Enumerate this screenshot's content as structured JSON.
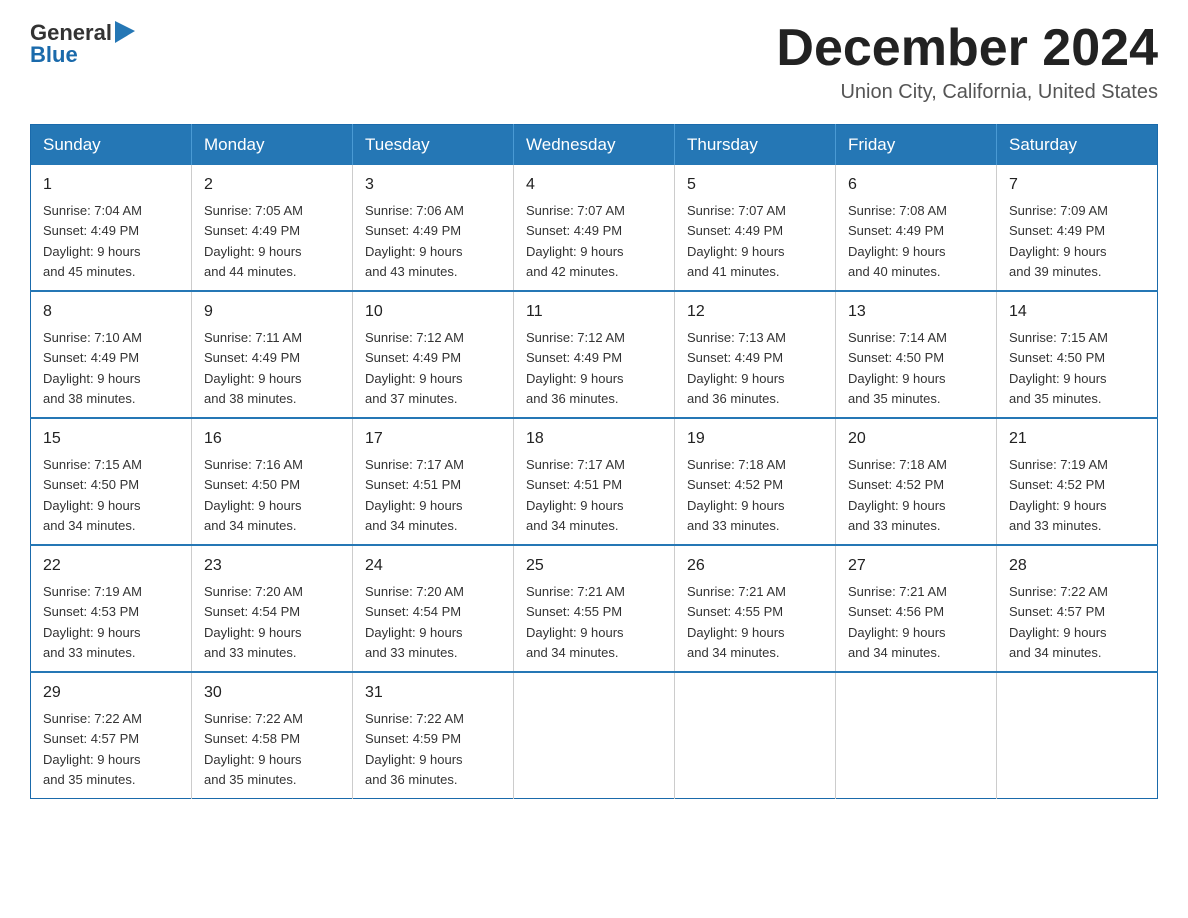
{
  "header": {
    "logo_general": "General",
    "logo_blue": "Blue",
    "month_title": "December 2024",
    "location": "Union City, California, United States"
  },
  "weekdays": [
    "Sunday",
    "Monday",
    "Tuesday",
    "Wednesday",
    "Thursday",
    "Friday",
    "Saturday"
  ],
  "weeks": [
    [
      {
        "day": "1",
        "sunrise": "7:04 AM",
        "sunset": "4:49 PM",
        "daylight": "9 hours and 45 minutes."
      },
      {
        "day": "2",
        "sunrise": "7:05 AM",
        "sunset": "4:49 PM",
        "daylight": "9 hours and 44 minutes."
      },
      {
        "day": "3",
        "sunrise": "7:06 AM",
        "sunset": "4:49 PM",
        "daylight": "9 hours and 43 minutes."
      },
      {
        "day": "4",
        "sunrise": "7:07 AM",
        "sunset": "4:49 PM",
        "daylight": "9 hours and 42 minutes."
      },
      {
        "day": "5",
        "sunrise": "7:07 AM",
        "sunset": "4:49 PM",
        "daylight": "9 hours and 41 minutes."
      },
      {
        "day": "6",
        "sunrise": "7:08 AM",
        "sunset": "4:49 PM",
        "daylight": "9 hours and 40 minutes."
      },
      {
        "day": "7",
        "sunrise": "7:09 AM",
        "sunset": "4:49 PM",
        "daylight": "9 hours and 39 minutes."
      }
    ],
    [
      {
        "day": "8",
        "sunrise": "7:10 AM",
        "sunset": "4:49 PM",
        "daylight": "9 hours and 38 minutes."
      },
      {
        "day": "9",
        "sunrise": "7:11 AM",
        "sunset": "4:49 PM",
        "daylight": "9 hours and 38 minutes."
      },
      {
        "day": "10",
        "sunrise": "7:12 AM",
        "sunset": "4:49 PM",
        "daylight": "9 hours and 37 minutes."
      },
      {
        "day": "11",
        "sunrise": "7:12 AM",
        "sunset": "4:49 PM",
        "daylight": "9 hours and 36 minutes."
      },
      {
        "day": "12",
        "sunrise": "7:13 AM",
        "sunset": "4:49 PM",
        "daylight": "9 hours and 36 minutes."
      },
      {
        "day": "13",
        "sunrise": "7:14 AM",
        "sunset": "4:50 PM",
        "daylight": "9 hours and 35 minutes."
      },
      {
        "day": "14",
        "sunrise": "7:15 AM",
        "sunset": "4:50 PM",
        "daylight": "9 hours and 35 minutes."
      }
    ],
    [
      {
        "day": "15",
        "sunrise": "7:15 AM",
        "sunset": "4:50 PM",
        "daylight": "9 hours and 34 minutes."
      },
      {
        "day": "16",
        "sunrise": "7:16 AM",
        "sunset": "4:50 PM",
        "daylight": "9 hours and 34 minutes."
      },
      {
        "day": "17",
        "sunrise": "7:17 AM",
        "sunset": "4:51 PM",
        "daylight": "9 hours and 34 minutes."
      },
      {
        "day": "18",
        "sunrise": "7:17 AM",
        "sunset": "4:51 PM",
        "daylight": "9 hours and 34 minutes."
      },
      {
        "day": "19",
        "sunrise": "7:18 AM",
        "sunset": "4:52 PM",
        "daylight": "9 hours and 33 minutes."
      },
      {
        "day": "20",
        "sunrise": "7:18 AM",
        "sunset": "4:52 PM",
        "daylight": "9 hours and 33 minutes."
      },
      {
        "day": "21",
        "sunrise": "7:19 AM",
        "sunset": "4:52 PM",
        "daylight": "9 hours and 33 minutes."
      }
    ],
    [
      {
        "day": "22",
        "sunrise": "7:19 AM",
        "sunset": "4:53 PM",
        "daylight": "9 hours and 33 minutes."
      },
      {
        "day": "23",
        "sunrise": "7:20 AM",
        "sunset": "4:54 PM",
        "daylight": "9 hours and 33 minutes."
      },
      {
        "day": "24",
        "sunrise": "7:20 AM",
        "sunset": "4:54 PM",
        "daylight": "9 hours and 33 minutes."
      },
      {
        "day": "25",
        "sunrise": "7:21 AM",
        "sunset": "4:55 PM",
        "daylight": "9 hours and 34 minutes."
      },
      {
        "day": "26",
        "sunrise": "7:21 AM",
        "sunset": "4:55 PM",
        "daylight": "9 hours and 34 minutes."
      },
      {
        "day": "27",
        "sunrise": "7:21 AM",
        "sunset": "4:56 PM",
        "daylight": "9 hours and 34 minutes."
      },
      {
        "day": "28",
        "sunrise": "7:22 AM",
        "sunset": "4:57 PM",
        "daylight": "9 hours and 34 minutes."
      }
    ],
    [
      {
        "day": "29",
        "sunrise": "7:22 AM",
        "sunset": "4:57 PM",
        "daylight": "9 hours and 35 minutes."
      },
      {
        "day": "30",
        "sunrise": "7:22 AM",
        "sunset": "4:58 PM",
        "daylight": "9 hours and 35 minutes."
      },
      {
        "day": "31",
        "sunrise": "7:22 AM",
        "sunset": "4:59 PM",
        "daylight": "9 hours and 36 minutes."
      },
      null,
      null,
      null,
      null
    ]
  ],
  "labels": {
    "sunrise_prefix": "Sunrise: ",
    "sunset_prefix": "Sunset: ",
    "daylight_prefix": "Daylight: "
  }
}
